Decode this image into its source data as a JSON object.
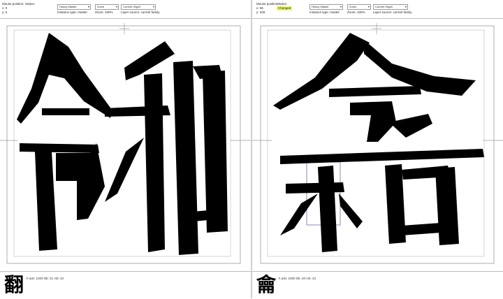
{
  "left": {
    "mouse_label": "Mouse position:",
    "mouse_x": "x: 0",
    "mouse_y": "y: 0",
    "status_label": "Status:",
    "status_value": "",
    "master_select": "Heavy Master",
    "instance_type": "Instance type: master",
    "zoom_select": "Zoom",
    "zoom_value": "Zoom: 100%",
    "glyph_select": "Current Glyph",
    "layer_source": "Layer source: current family",
    "glyph_char": "翻",
    "metrics": "h adv: 1000  lsb: 21  rsb: 23"
  },
  "right": {
    "mouse_label": "Mouse position:",
    "mouse_x": "x: 56",
    "mouse_y": "y: 346",
    "status_label": "Status:",
    "status_value": "Changed",
    "master_select": "Heavy Master",
    "instance_type": "Instance type: master",
    "zoom_select": "Zoom",
    "zoom_value": "Zoom: 100%",
    "glyph_select": "Current Glyph",
    "layer_source": "Layer source: current family",
    "glyph_char": "龠",
    "metrics": "h adv: 1000  lsb: 20  rsb: 23"
  },
  "colors": {
    "status_changed": "#e8f56a",
    "ink": "#000000",
    "guide": "#9a9a9a"
  },
  "icons": {
    "dropdown": "chevron-down-icon"
  }
}
